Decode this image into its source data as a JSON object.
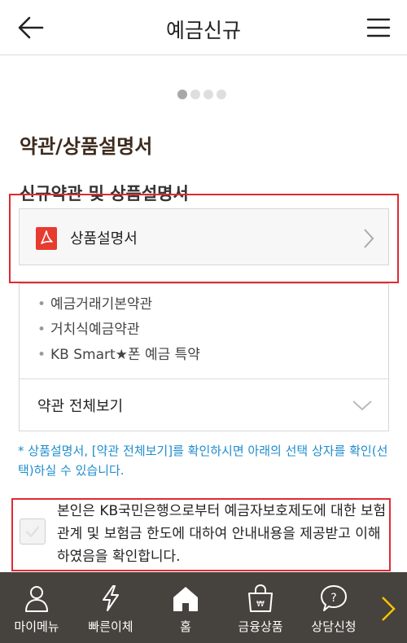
{
  "header": {
    "title": "예금신규"
  },
  "pager": {
    "total": 4,
    "active": 0
  },
  "section": {
    "title": "약관/상품설명서",
    "subtitle": "신규약관 및 상품설명서"
  },
  "product_doc": {
    "label": "상품설명서"
  },
  "terms": {
    "items": [
      "예금거래기본약관",
      "거치식예금약관",
      "KB Smart★폰 예금 특약"
    ],
    "view_all_label": "약관 전체보기"
  },
  "note": "* 상품설명서, [약관 전체보기]를 확인하시면 아래의 선택 상자를 확인(선택)하실 수 있습니다.",
  "consent": {
    "text": "본인은 KB국민은행으로부터 예금자보호제도에 대한 보험관계 및 보험금 한도에 대하여 안내내용을 제공받고 이해하였음을 확인합니다.",
    "checked": false
  },
  "tabbar": {
    "tabs": [
      {
        "label": "마이메뉴",
        "icon": "person-icon"
      },
      {
        "label": "빠른이체",
        "icon": "lightning-icon"
      },
      {
        "label": "홈",
        "icon": "home-icon"
      },
      {
        "label": "금융상품",
        "icon": "shopping-bag-icon"
      },
      {
        "label": "상담신청",
        "icon": "question-bubble-icon"
      }
    ]
  },
  "colors": {
    "accent_yellow": "#f9c300",
    "highlight_red": "#e02a32",
    "note_blue": "#1e8ccd",
    "tabbar_bg": "#46423d",
    "section_title": "#3d2b1f"
  }
}
